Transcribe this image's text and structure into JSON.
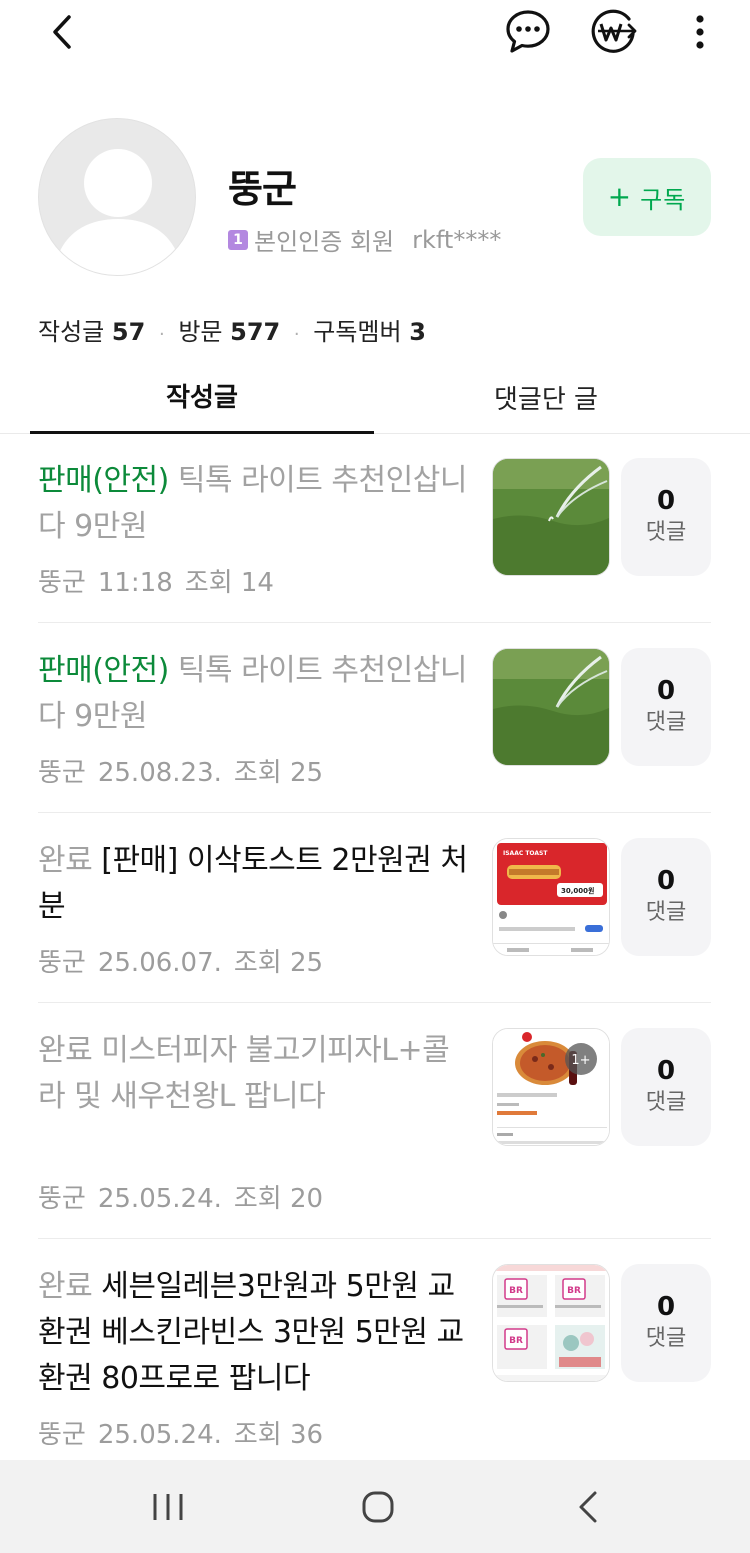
{
  "topbar": {
    "back_icon": "chevron-left-icon",
    "chat_icon": "chat-bubble-dots-icon",
    "pay_icon": "won-transfer-icon",
    "more_icon": "more-vertical-icon"
  },
  "profile": {
    "nickname": "뚱군",
    "verify_badge": "1",
    "verify_label": "본인인증 회원",
    "user_id": "rkft****",
    "subscribe_plus": "+",
    "subscribe_label": "구독"
  },
  "stats": {
    "posts_label": "작성글",
    "posts_count": "57",
    "visits_label": "방문",
    "visits_count": "577",
    "members_label": "구독멤버",
    "members_count": "3"
  },
  "tabs": [
    {
      "label": "작성글",
      "active": true
    },
    {
      "label": "댓글단 글",
      "active": false
    }
  ],
  "posts": [
    {
      "prefix": "판매(안전)",
      "title": " 틱톡 라이트 추천인삽니다 9만원",
      "author": "뚱군",
      "date": "11:18",
      "views": "조회 14",
      "comment_count": "0",
      "comment_label": "댓글",
      "thumb": "grass-sprinkler"
    },
    {
      "prefix": "판매(안전)",
      "title": " 틱톡 라이트 추천인삽니다 9만원",
      "author": "뚱군",
      "date": "25.08.23.",
      "views": "조회 25",
      "comment_count": "0",
      "comment_label": "댓글",
      "thumb": "grass-sprinkler"
    },
    {
      "prefix": "완료",
      "title": " [판매] 이삭토스트 2만원권 처분",
      "author": "뚱군",
      "date": "25.06.07.",
      "views": "조회 25",
      "comment_count": "0",
      "comment_label": "댓글",
      "thumb": "isaac-toast-coupon",
      "thumb_brand": "ISAAC TOAST",
      "thumb_price": "30,000원"
    },
    {
      "prefix": "완료",
      "title": " 미스터피자 불고기피자L+콜라 및 새우천왕L 팝니다",
      "author": "뚱군",
      "date": "25.05.24.",
      "views": "조회 20",
      "comment_count": "0",
      "comment_label": "댓글",
      "thumb": "pizza-coupon",
      "thumb_badge": "1+"
    },
    {
      "prefix": "완료",
      "title": " 세븐일레븐3만원과 5만원 교환권 베스킨라빈스 3만원 5만원 교환권 80프로로 팝니다",
      "author": "뚱군",
      "date": "25.05.24.",
      "views": "조회 36",
      "comment_count": "0",
      "comment_label": "댓글",
      "thumb": "baskin-robbins-coupons",
      "thumb_brand": "BR"
    }
  ],
  "navbar": {
    "recents_icon": "recent-apps-icon",
    "home_icon": "home-icon",
    "back_icon": "nav-back-icon"
  },
  "colors": {
    "accent_green": "#0c8a3a",
    "subscribe_bg": "#e3f6ea",
    "subscribe_text": "#00a84f",
    "muted_text": "#9c9c9c"
  }
}
